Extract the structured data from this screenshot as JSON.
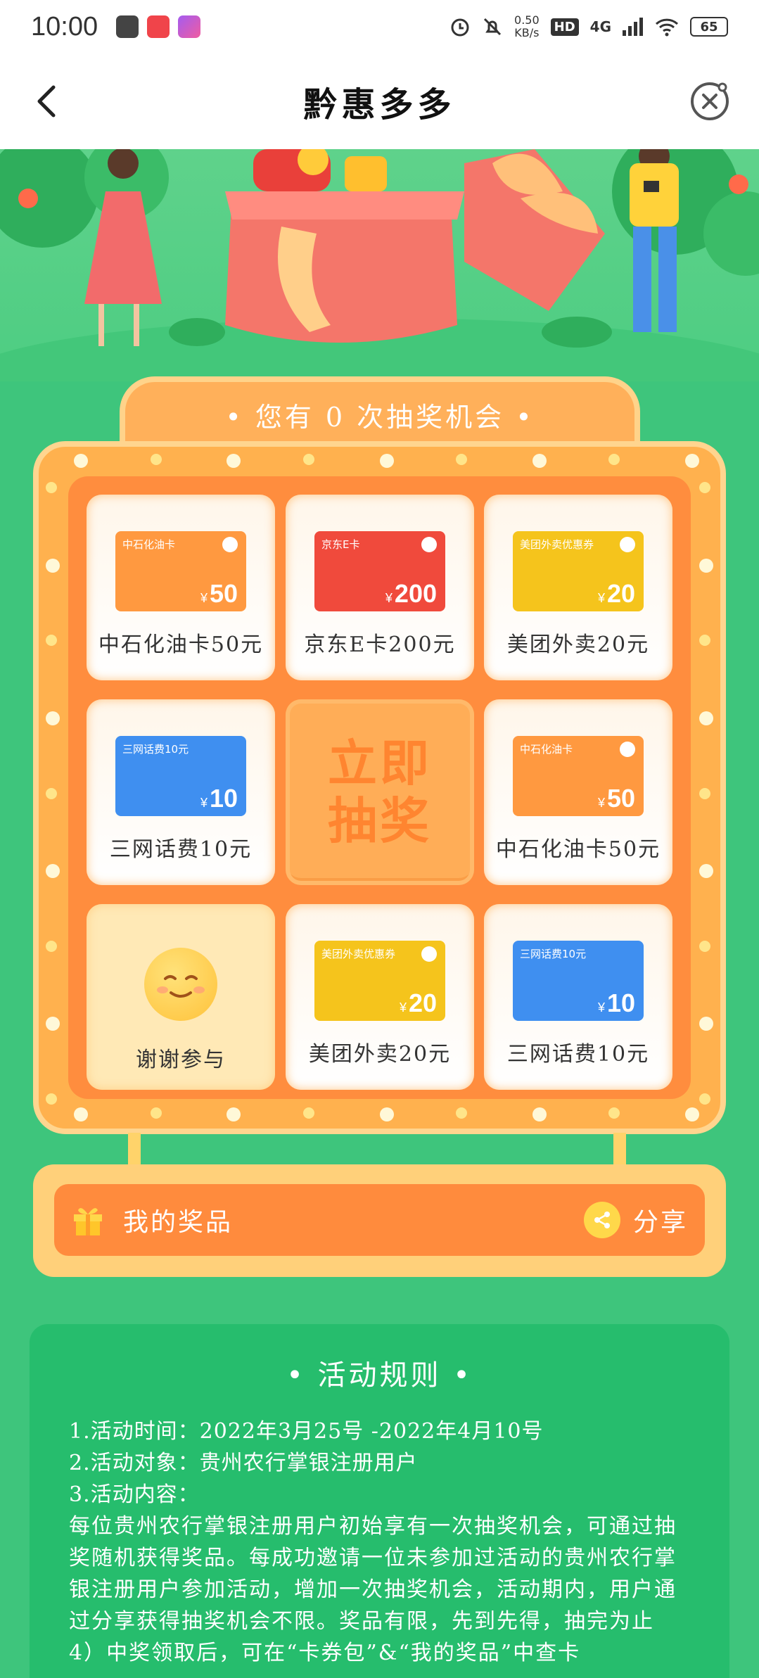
{
  "status_bar": {
    "time": "10:00",
    "net_speed": "0.50",
    "net_unit": "KB/s",
    "hd": "HD",
    "network": "4G",
    "battery": "65"
  },
  "nav": {
    "title": "黔惠多多"
  },
  "lottery": {
    "chances_text": "•  您有 0 次抽奖机会  •",
    "draw_button": "立即\n抽奖",
    "prizes": [
      {
        "label": "中石化油卡50元",
        "card_title": "中石化油卡",
        "amount": "50",
        "type": "oil"
      },
      {
        "label": "京东E卡200元",
        "card_title": "京东E卡",
        "amount": "200",
        "type": "jd"
      },
      {
        "label": "美团外卖20元",
        "card_title": "美团外卖优惠券",
        "amount": "20",
        "type": "meituan"
      },
      {
        "label": "三网话费10元",
        "card_title": "三网话费10元",
        "amount": "10",
        "type": "phone"
      },
      {
        "label": "中石化油卡50元",
        "card_title": "中石化油卡",
        "amount": "50",
        "type": "oil"
      },
      {
        "label": "谢谢参与",
        "type": "thanks"
      },
      {
        "label": "美团外卖20元",
        "card_title": "美团外卖优惠券",
        "amount": "20",
        "type": "meituan"
      },
      {
        "label": "三网话费10元",
        "card_title": "三网话费10元",
        "amount": "10",
        "type": "phone"
      }
    ],
    "yen": "¥"
  },
  "prize_bar": {
    "my_prizes": "我的奖品",
    "share": "分享"
  },
  "rules": {
    "title": "•  活动规则  •",
    "lines": [
      "1.活动时间：2022年3月25号 -2022年4月10号",
      "2.活动对象：贵州农行掌银注册用户",
      "3.活动内容："
    ],
    "content": "每位贵州农行掌银注册用户初始享有一次抽奖机会，可通过抽奖随机获得奖品。每成功邀请一位未参加过活动的贵州农行掌银注册用户参加活动，增加一次抽奖机会，活动期内，用户通过分享获得抽奖机会不限。奖品有限，先到先得，抽完为止",
    "cut_line": "4）中奖领取后，可在“卡券包”&“我的奖品”中查卡"
  },
  "colors": {
    "background": "#3ec57c",
    "board": "#ffb14e",
    "board_inner": "#ff8d3e",
    "rules_panel": "#26bd6d"
  }
}
